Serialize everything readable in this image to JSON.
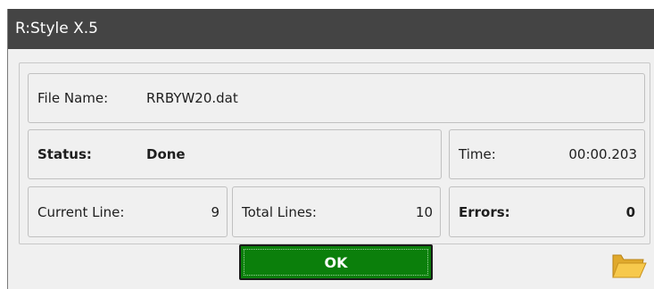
{
  "window": {
    "title": "R:Style X.5"
  },
  "file": {
    "label": "File Name:",
    "value": "RRBYW20.dat"
  },
  "status": {
    "label": "Status:",
    "value": "Done"
  },
  "time": {
    "label": "Time:",
    "value": "00:00.203"
  },
  "current_line": {
    "label": "Current Line:",
    "value": "9"
  },
  "total_lines": {
    "label": "Total Lines:",
    "value": "10"
  },
  "errors": {
    "label": "Errors:",
    "value": "0"
  },
  "buttons": {
    "ok_label": "OK"
  },
  "icons": {
    "folder": "folder-icon"
  },
  "colors": {
    "titlebar": "#444444",
    "ok_button": "#0b7f0b",
    "folder": "#f4c542"
  }
}
